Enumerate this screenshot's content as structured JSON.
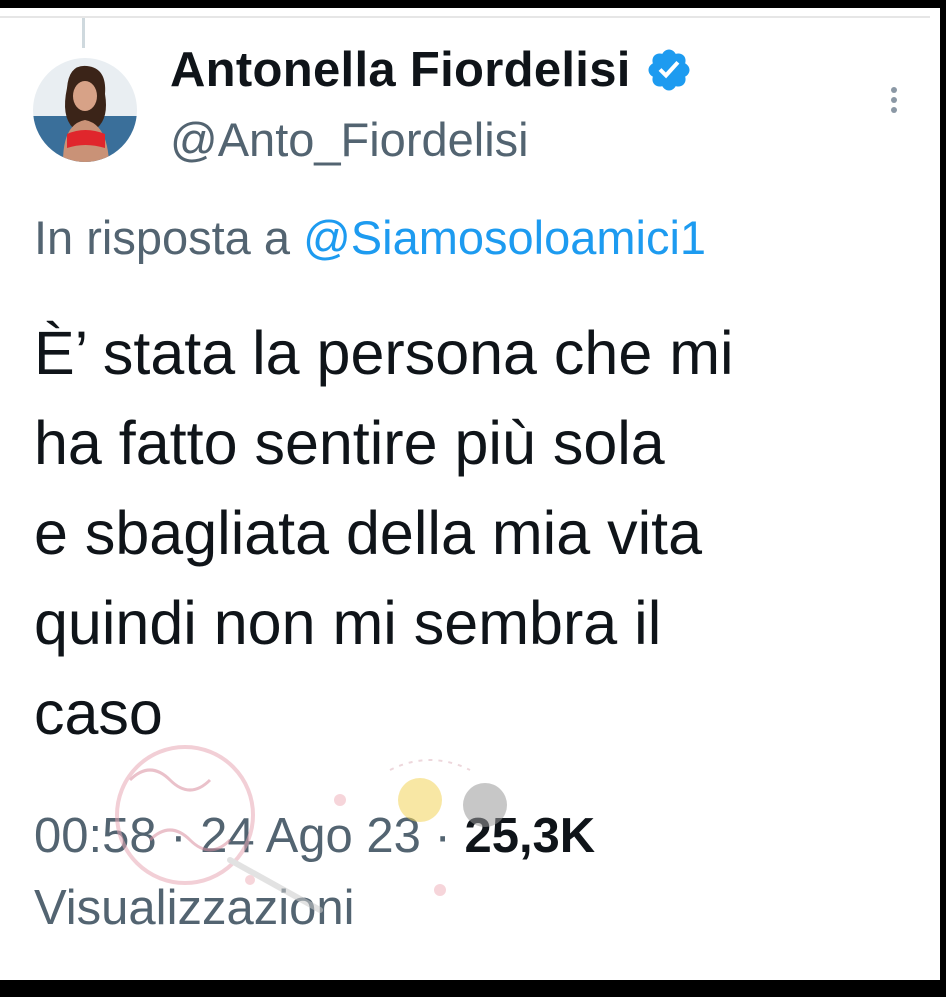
{
  "author": {
    "display_name": "Antonella Fiordelisi",
    "handle": "@Anto_Fiordelisi",
    "verified_color": "#1d9bf0"
  },
  "reply": {
    "prefix": "In risposta a ",
    "to_handle": "@Siamosoloamici1"
  },
  "tweet": {
    "lines": [
      "È’ stata la persona che mi",
      "ha fatto sentire più sola",
      "e sbagliata della mia vita",
      "quindi non mi sembra il",
      "caso"
    ]
  },
  "meta": {
    "time": "00:58",
    "separator": " · ",
    "date": "24 Ago 23",
    "views_count": "25,3K",
    "views_label": "Visualizzazioni"
  },
  "icons": {
    "verified": "verified-badge-icon",
    "more": "more-vertical-icon"
  },
  "colors": {
    "text": "#0f1419",
    "secondary": "#536471",
    "link": "#1d9bf0"
  }
}
